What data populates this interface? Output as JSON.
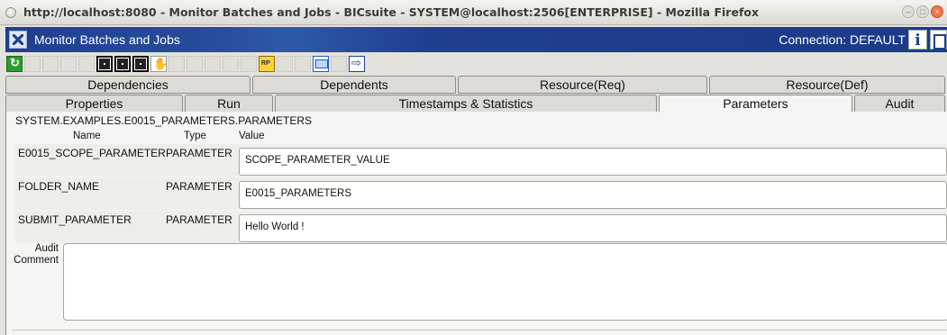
{
  "window": {
    "title": "http://localhost:8080 - Monitor Batches and Jobs - BICsuite - SYSTEM@localhost:2506[ENTERPRISE] - Mozilla Firefox"
  },
  "header": {
    "title": "Monitor Batches and Jobs",
    "connection": "Connection: DEFAULT",
    "info_label": "i"
  },
  "toolbar": {
    "icons": [
      "refresh-icon",
      "back-icon",
      "download-icon",
      "edit-icon",
      "text-icon",
      "grid-icon",
      "grid-icon",
      "grid-icon",
      "stop-icon",
      "hand-icon",
      "run-icon",
      "tool-icon",
      "tree-icon",
      "forward-icon",
      "restart-icon",
      "cancel-icon",
      "kill-icon",
      "message-icon",
      "copy-icon",
      "arrow-icon"
    ]
  },
  "tabs": {
    "row1": [
      "Dependencies",
      "Dependents",
      "Resource(Req)",
      "Resource(Def)"
    ],
    "row2": [
      "Properties",
      "Run",
      "Timestamps & Statistics",
      "Parameters",
      "Audit"
    ],
    "selected": "Parameters"
  },
  "panel": {
    "path": "SYSTEM.EXAMPLES.E0015_PARAMETERS.PARAMETERS",
    "columns": {
      "name": "Name",
      "type": "Type",
      "value": "Value"
    },
    "rows": [
      {
        "name": "E0015_SCOPE_PARAMETER",
        "type": "PARAMETER",
        "value": "SCOPE_PARAMETER_VALUE"
      },
      {
        "name": "FOLDER_NAME",
        "type": "PARAMETER",
        "value": "E0015_PARAMETERS"
      },
      {
        "name": "SUBMIT_PARAMETER",
        "type": "PARAMETER",
        "value": "Hello World !"
      }
    ],
    "audit_label_1": "Audit",
    "audit_label_2": "Comment",
    "audit_comment": ""
  }
}
